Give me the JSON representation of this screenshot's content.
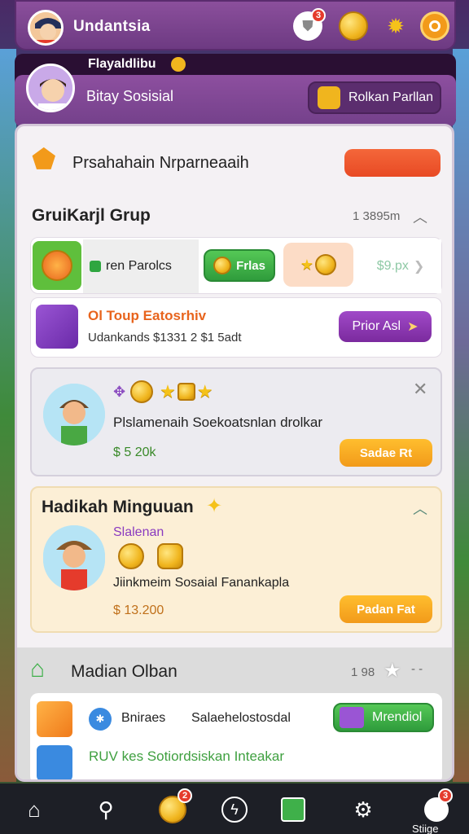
{
  "header": {
    "title": "Undantsia",
    "notification_badge": "3"
  },
  "profile": {
    "top_label": "Flayaldlibu",
    "name": "Bitay Sosisial",
    "button_label": "Rolkan Parllan"
  },
  "section1": {
    "title": "Prsahahain Nrparneaaih"
  },
  "group": {
    "title": "GruiKarjl Grup",
    "meta": "1 3895m",
    "chip1_label": "ren Parolcs",
    "chip2_label": "Frlas",
    "chip4_label": "$9.px"
  },
  "event_card": {
    "title": "Ol Toup Eatosrhiv",
    "subtitle": "Udankands $1331 2 $1 5adt",
    "button_label": "Prior Asl"
  },
  "friend_card": {
    "text": "Plslamenaih Soekoatsnlan drolkar",
    "amount": "$ 5 20k",
    "button_label": "Sadae Rt"
  },
  "weekly": {
    "title": "Hadikah Minguuan",
    "subtitle": "Slalenan",
    "text": "Jiinkmeim Sosaial Fanankapla",
    "amount": "$ 13.200",
    "button_label": "Padan Fat"
  },
  "invite": {
    "title": "Madian Olban",
    "meta": "1 98",
    "row_label1": "Bniraes",
    "row_label2": "Salaehelostosdal",
    "row_button": "Mrendiol",
    "footer_text": "RUV kes Sotiordsiskan Inteakar"
  },
  "nav": {
    "last_label": "Stiige",
    "badge_bolt": "2",
    "badge_last": "3"
  },
  "colors": {
    "purple": "#7a4290",
    "orange": "#f29a1a",
    "green": "#3fb04a",
    "red": "#f0532c"
  }
}
